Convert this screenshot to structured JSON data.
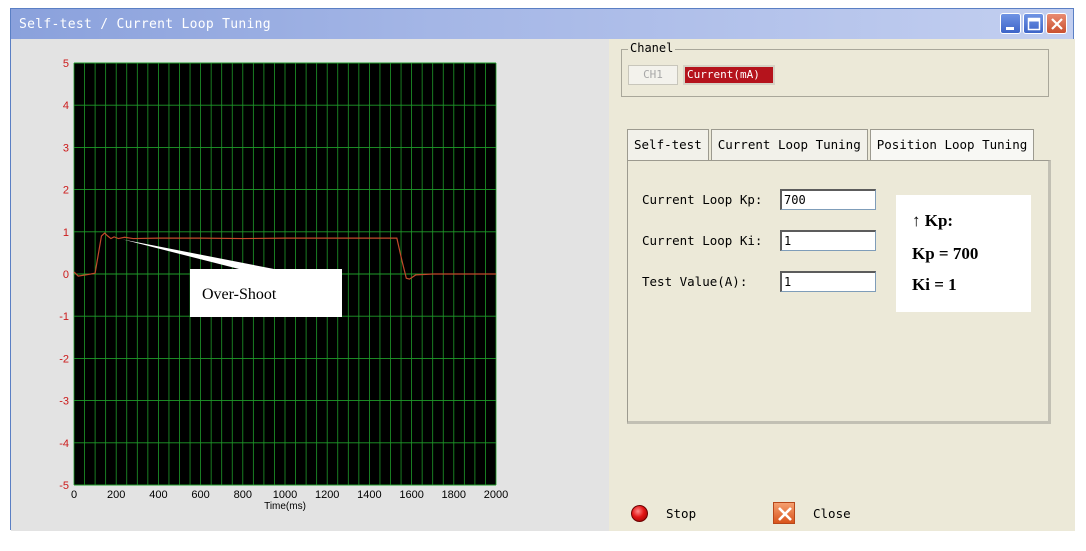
{
  "window": {
    "title": "Self-test / Current Loop Tuning"
  },
  "chart_data": {
    "type": "line",
    "xlabel": "Time(ms)",
    "ylabel": "",
    "xlim": [
      0,
      2000
    ],
    "ylim": [
      -5,
      5
    ],
    "x_ticks": [
      "0",
      "200",
      "400",
      "600",
      "800",
      "1000",
      "1200",
      "1400",
      "1600",
      "1800",
      "2000"
    ],
    "y_ticks": [
      "5",
      "4",
      "3",
      "2",
      "1",
      "0",
      "-1",
      "-2",
      "-3",
      "-4",
      "-5"
    ],
    "grid": true,
    "annotation": "Over-Shoot",
    "series": [
      {
        "x": [
          0,
          20,
          80,
          100,
          130,
          145,
          160,
          175,
          190,
          210,
          240,
          280,
          400,
          600,
          800,
          1000,
          1200,
          1400,
          1480,
          1530,
          1555,
          1575,
          1590,
          1620,
          1700,
          1800,
          1900,
          2000
        ],
        "y": [
          0.05,
          -0.05,
          0.0,
          0.02,
          0.9,
          0.97,
          0.9,
          0.84,
          0.88,
          0.84,
          0.87,
          0.84,
          0.85,
          0.85,
          0.84,
          0.85,
          0.85,
          0.85,
          0.85,
          0.85,
          0.3,
          -0.1,
          -0.12,
          -0.02,
          0.0,
          0.0,
          0.0,
          0.0
        ]
      }
    ]
  },
  "channel": {
    "group_label": "Chanel",
    "ch_button": "CH1",
    "selection": "Current(mA)"
  },
  "tabs": [
    {
      "label": "Self-test"
    },
    {
      "label": "Current Loop Tuning"
    },
    {
      "label": "Position Loop Tuning"
    }
  ],
  "form": {
    "kp_label": "Current Loop Kp:",
    "kp_value": "700",
    "ki_label": "Current Loop Ki:",
    "ki_value": "1",
    "test_label": "Test Value(A):",
    "test_value": "1"
  },
  "note": {
    "line1": "↑ Kp:",
    "line2": "Kp = 700",
    "line3": "Ki = 1"
  },
  "buttons": {
    "stop": "Stop",
    "close": "Close"
  },
  "colors": {
    "plot_bg": "#000000",
    "grid": "#1f9b2a",
    "trace": "#c24a2a",
    "tick_label": "#cc1a1a"
  }
}
